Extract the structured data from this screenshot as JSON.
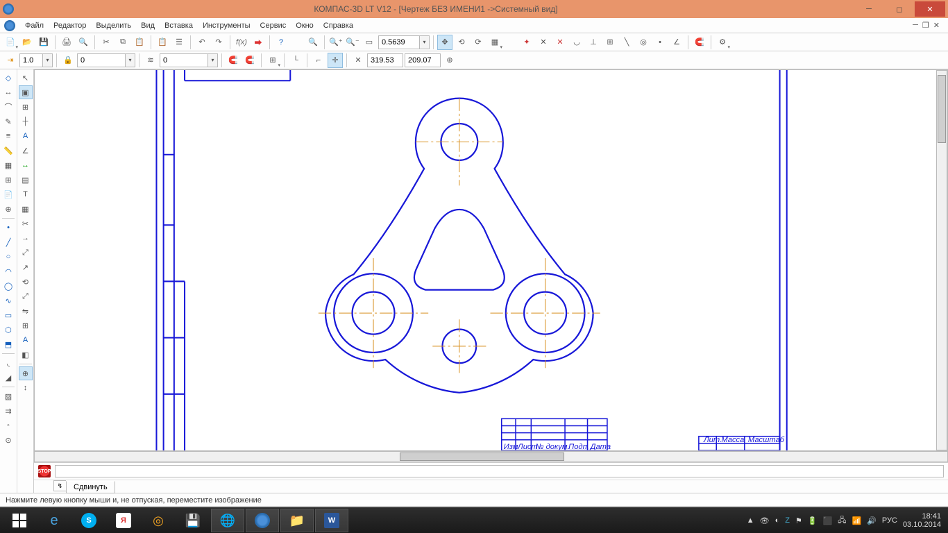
{
  "titlebar": {
    "title": "КОМПАС-3D LT V12 - [Чертеж БЕЗ ИМЕНИ1 ->Системный вид]"
  },
  "menubar": {
    "items": [
      "Файл",
      "Редактор",
      "Выделить",
      "Вид",
      "Вставка",
      "Инструменты",
      "Сервис",
      "Окно",
      "Справка"
    ]
  },
  "toolbar1": {
    "zoom_value": "0.5639"
  },
  "toolbar2": {
    "step": "1.0",
    "style": "0",
    "layer": "0",
    "coord_x": "319.53",
    "coord_y": "209.07"
  },
  "prop": {
    "tab": "Сдвинуть"
  },
  "status": {
    "text": "Нажмите левую кнопку мыши и, не отпуская, переместите изображение"
  },
  "tray": {
    "lang": "РУС",
    "time": "18:41",
    "date": "03.10.2014"
  },
  "titleblock": {
    "col1": "Изм",
    "col2": "Лист",
    "col3": "№ докум.",
    "col4": "Подп.",
    "col5": "Дата",
    "lit": "Лит.",
    "mass": "Масса",
    "scale": "Масштаб"
  }
}
